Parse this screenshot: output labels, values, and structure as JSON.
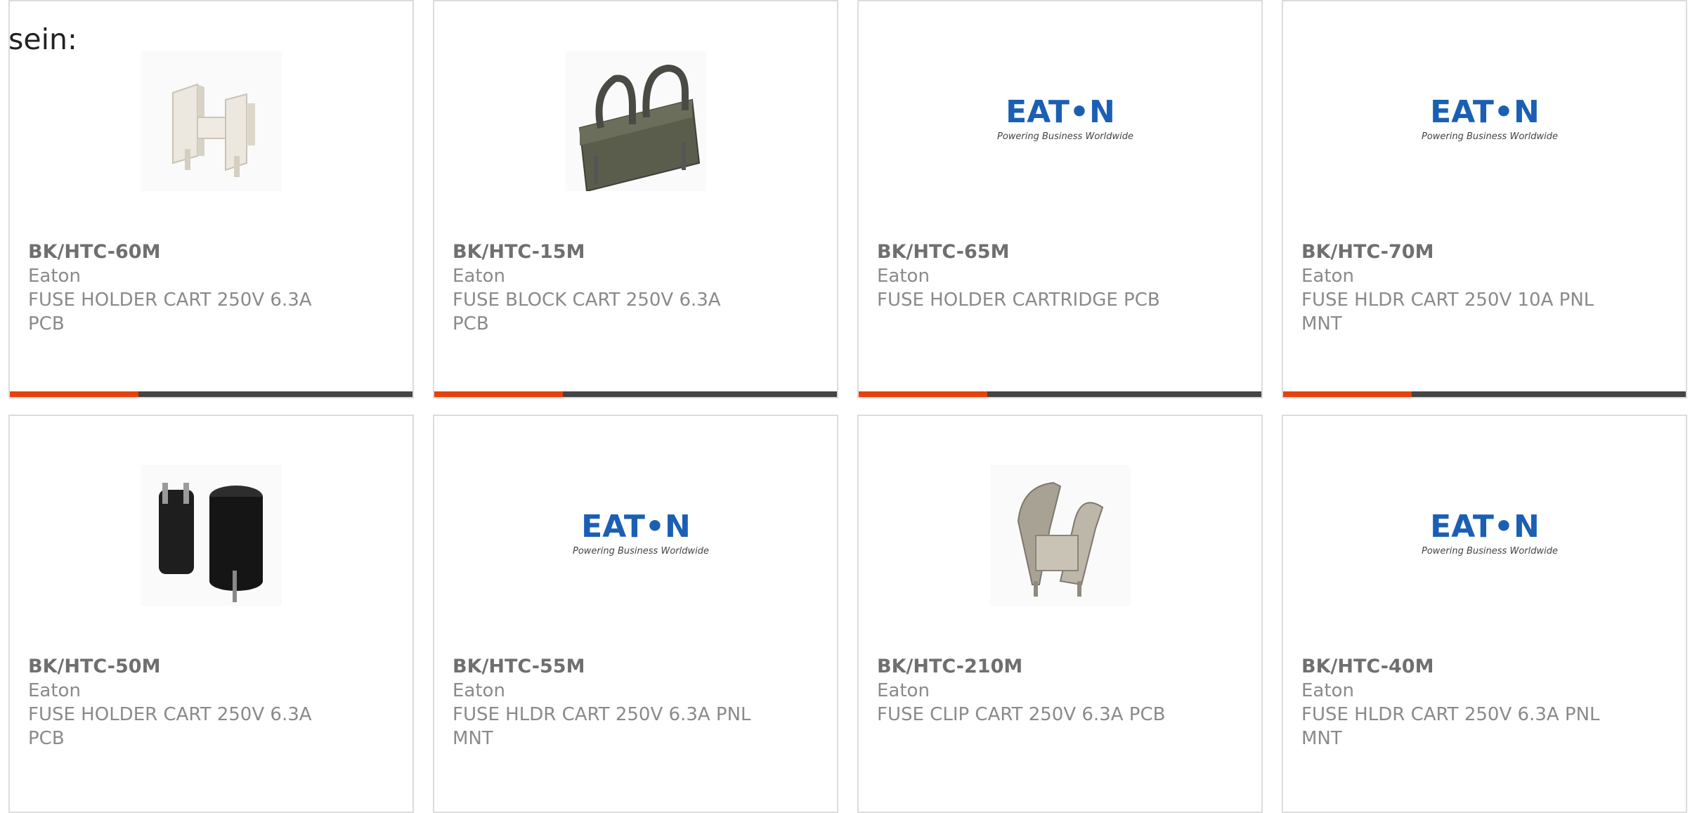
{
  "intro": "sein:",
  "colors": {
    "accent": "#e8400c",
    "bar": "#444444",
    "border": "#dcdcdc",
    "eaton_blue": "#1a5fb4"
  },
  "products": [
    {
      "pn": "BK/HTC-60M",
      "manufacturer": "Eaton",
      "description": "FUSE HOLDER CART 250V 6.3A PCB",
      "image": "white-fuse-holder-image"
    },
    {
      "pn": "BK/HTC-15M",
      "manufacturer": "Eaton",
      "description": "FUSE BLOCK CART 250V 6.3A PCB",
      "image": "fuse-block-image"
    },
    {
      "pn": "BK/HTC-65M",
      "manufacturer": "Eaton",
      "description": "FUSE HOLDER CARTRIDGE PCB",
      "image": "eaton-logo"
    },
    {
      "pn": "BK/HTC-70M",
      "manufacturer": "Eaton",
      "description": "FUSE HLDR CART 250V 10A PNL MNT",
      "image": "eaton-logo"
    },
    {
      "pn": "BK/HTC-50M",
      "manufacturer": "Eaton",
      "description": "FUSE HOLDER CART 250V 6.3A PCB",
      "image": "black-fuse-holder-image"
    },
    {
      "pn": "BK/HTC-55M",
      "manufacturer": "Eaton",
      "description": "FUSE HLDR CART 250V 6.3A PNL MNT",
      "image": "eaton-logo"
    },
    {
      "pn": "BK/HTC-210M",
      "manufacturer": "Eaton",
      "description": "FUSE CLIP CART 250V 6.3A PCB",
      "image": "fuse-clip-image"
    },
    {
      "pn": "BK/HTC-40M",
      "manufacturer": "Eaton",
      "description": "FUSE HLDR CART 250V 6.3A PNL MNT",
      "image": "eaton-logo"
    }
  ],
  "eaton_logo": {
    "wordmark": "EAT•N",
    "tagline": "Powering Business Worldwide"
  }
}
